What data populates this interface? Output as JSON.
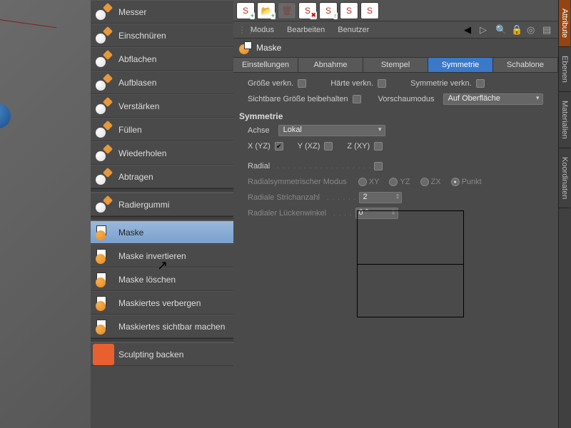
{
  "tools": [
    {
      "label": "Messer"
    },
    {
      "label": "Einschnüren"
    },
    {
      "label": "Abflachen"
    },
    {
      "label": "Aufblasen"
    },
    {
      "label": "Verstärken"
    },
    {
      "label": "Füllen"
    },
    {
      "label": "Wiederholen"
    },
    {
      "label": "Abtragen"
    }
  ],
  "eraser": {
    "label": "Radiergummi"
  },
  "mask_tools": [
    {
      "label": "Maske",
      "selected": true
    },
    {
      "label": "Maske invertieren"
    },
    {
      "label": "Maske löschen"
    },
    {
      "label": "Maskiertes verbergen"
    },
    {
      "label": "Maskiertes sichtbar machen"
    }
  ],
  "bake": {
    "label": "Sculpting backen"
  },
  "mode_bar": {
    "modus": "Modus",
    "bearbeiten": "Bearbeiten",
    "benutzer": "Benutzer"
  },
  "object": {
    "title": "Maske"
  },
  "tabs": [
    {
      "label": "Einstellungen"
    },
    {
      "label": "Abnahme"
    },
    {
      "label": "Stempel"
    },
    {
      "label": "Symmetrie",
      "active": true
    },
    {
      "label": "Schablone"
    }
  ],
  "props": {
    "groesse_verkn": "Größe verkn.",
    "haerte_verkn": "Härte verkn.",
    "symmetrie_verkn": "Symmetrie verkn.",
    "sichtbare_groesse": "Sichtbare Größe beibehalten",
    "vorschaumodus": "Vorschaumodus",
    "vorschau_value": "Auf Oberfläche",
    "section": "Symmetrie",
    "achse": "Achse",
    "achse_value": "Lokal",
    "x_yz": "X (YZ)",
    "y_xz": "Y (XZ)",
    "z_xy": "Z (XY)",
    "radial": "Radial",
    "radial_modus": "Radialsymmetrischer Modus",
    "rad_xy": "XY",
    "rad_yz": "YZ",
    "rad_zx": "ZX",
    "rad_punkt": "Punkt",
    "strichzahl": "Radiale Strichanzahl",
    "strichzahl_val": "2",
    "lueckenwinkel": "Radialer Lückenwinkel",
    "lueckenwinkel_val": "0 °"
  },
  "side_tabs": [
    "Attribute",
    "Ebenen",
    "Materialien",
    "Koordinaten"
  ]
}
